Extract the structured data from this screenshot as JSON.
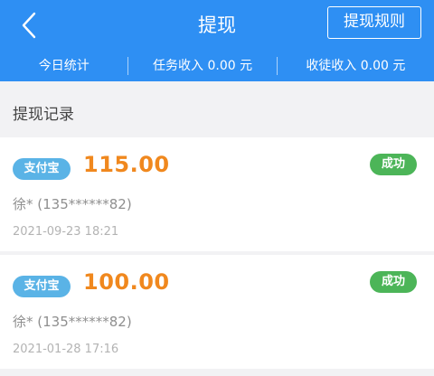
{
  "header": {
    "title": "提现",
    "rules_label": "提现规则",
    "back_icon": "chevron-left-icon"
  },
  "stats": {
    "today": "今日统计",
    "task_income": "任务收入 0.00 元",
    "apprentice_income": "收徒收入 0.00 元"
  },
  "section": {
    "title": "提现记录"
  },
  "records": [
    {
      "method": "支付宝",
      "amount": "115.00",
      "status": "成功",
      "account": "徐* (135******82)",
      "time": "2021-09-23 18:21"
    },
    {
      "method": "支付宝",
      "amount": "100.00",
      "status": "成功",
      "account": "徐* (135******82)",
      "time": "2021-01-28 17:16"
    }
  ],
  "colors": {
    "primary": "#2e8ff3",
    "badge_blue": "#5ab3e6",
    "amount_orange": "#f0881e",
    "success_green": "#4cb558",
    "background": "#f2f2f4"
  }
}
